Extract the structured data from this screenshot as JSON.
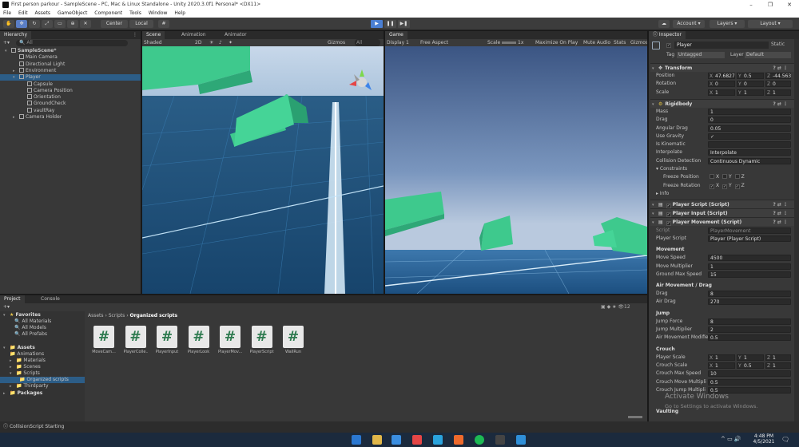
{
  "window": {
    "title": "First person parkour - SampleScene - PC, Mac & Linux Standalone - Unity 2020.3.0f1 Personal* <DX11>",
    "controls": [
      "–",
      "❐",
      "✕"
    ]
  },
  "menu": [
    "File",
    "Edit",
    "Assets",
    "GameObject",
    "Component",
    "Tools",
    "Window",
    "Help"
  ],
  "toolbar": {
    "pivot": "Center",
    "space": "Local",
    "account": "Account",
    "layers": "Layers",
    "layout": "Layout"
  },
  "hierarchy": {
    "tab": "Hierarchy",
    "search": "All",
    "items": [
      {
        "label": "SampleScene*",
        "indent": 0
      },
      {
        "label": "Main Camera",
        "indent": 1
      },
      {
        "label": "Directional Light",
        "indent": 1
      },
      {
        "label": "Environment",
        "indent": 1
      },
      {
        "label": "Player",
        "indent": 1
      },
      {
        "label": "Capsule",
        "indent": 2
      },
      {
        "label": "Camera Position",
        "indent": 2
      },
      {
        "label": "Orientation",
        "indent": 2
      },
      {
        "label": "GroundCheck",
        "indent": 2
      },
      {
        "label": "vaultRay",
        "indent": 2
      },
      {
        "label": "Camera Holder",
        "indent": 1
      }
    ]
  },
  "scene": {
    "tabs": [
      "Scene",
      "Animation",
      "Animator"
    ],
    "shading": "Shaded",
    "mode2d": "2D",
    "gizmos": "Gizmos",
    "search": "All"
  },
  "game": {
    "tab": "Game",
    "display": "Display 1",
    "aspect": "Free Aspect",
    "scale_label": "Scale",
    "scale": "1x",
    "options": [
      "Maximize On Play",
      "Mute Audio",
      "Stats",
      "Gizmos"
    ]
  },
  "project": {
    "tabs": [
      "Project",
      "Console"
    ],
    "favorites_label": "Favorites",
    "favorites": [
      "All Materials",
      "All Models",
      "All Prefabs"
    ],
    "assets_label": "Assets",
    "folders": [
      "Animations",
      "Materials",
      "Scenes",
      "Scripts",
      "Organized scripts",
      "Thirdparty"
    ],
    "packages_label": "Packages",
    "breadcrumb": [
      "Assets",
      "Scripts",
      "Organized scripts"
    ],
    "files": [
      "MoveCam...",
      "PlayerColle...",
      "PlayerInput",
      "PlayerLook",
      "PlayerMov...",
      "PlayerScript",
      "WallRun"
    ],
    "count": "12"
  },
  "status": {
    "message": "CollisionScript Starting"
  },
  "inspector": {
    "tab": "Inspector",
    "object": "Player",
    "static": "Static",
    "tag_label": "Tag",
    "tag": "Untagged",
    "layer_label": "Layer",
    "layer": "Default",
    "transform": {
      "title": "Transform",
      "rows": [
        {
          "label": "Position",
          "x": "47.6827",
          "y": "0.5",
          "z": "-44.563"
        },
        {
          "label": "Rotation",
          "x": "0",
          "y": "0",
          "z": "0"
        },
        {
          "label": "Scale",
          "x": "1",
          "y": "1",
          "z": "1"
        }
      ]
    },
    "rigidbody": {
      "title": "Rigidbody",
      "rows": [
        {
          "label": "Mass",
          "value": "1"
        },
        {
          "label": "Drag",
          "value": "0"
        },
        {
          "label": "Angular Drag",
          "value": "0.05"
        },
        {
          "label": "Use Gravity",
          "value": "✓"
        },
        {
          "label": "Is Kinematic",
          "value": ""
        },
        {
          "label": "Interpolate",
          "value": "Interpolate"
        },
        {
          "label": "Collision Detection",
          "value": "Continuous Dynamic"
        }
      ],
      "constraints": "Constraints",
      "freeze_pos": "Freeze Position",
      "freeze_rot": "Freeze Rotation",
      "axes": [
        "X",
        "Y",
        "Z"
      ],
      "info": "Info"
    },
    "components": [
      "Player Script (Script)",
      "Player Input (Script)",
      "Player Movement (Script)"
    ],
    "script_label": "Script",
    "script_value": "PlayerMovement",
    "player_script_label": "Player Script",
    "player_script_value": "Player (Player Script)",
    "movement": {
      "title": "Movement",
      "rows": [
        {
          "label": "Move Speed",
          "value": "4500"
        },
        {
          "label": "Move Multiplier",
          "value": "1"
        },
        {
          "label": "Ground Max Speed",
          "value": "15"
        }
      ]
    },
    "air": {
      "title": "Air Movement / Drag",
      "rows": [
        {
          "label": "Drag",
          "value": "8"
        },
        {
          "label": "Air Drag",
          "value": "270"
        }
      ]
    },
    "jump": {
      "title": "Jump",
      "rows": [
        {
          "label": "Jump Force",
          "value": "8"
        },
        {
          "label": "Jump Multiplier",
          "value": "2"
        },
        {
          "label": "Air Movement Modifie",
          "value": "0.5"
        }
      ]
    },
    "crouch": {
      "title": "Crouch",
      "player_scale": {
        "label": "Player Scale",
        "x": "1",
        "y": "1",
        "z": "1"
      },
      "crouch_scale": {
        "label": "Crouch Scale",
        "x": "1",
        "y": "0.5",
        "z": "1"
      },
      "rows": [
        {
          "label": "Crouch Max Speed",
          "value": "10"
        },
        {
          "label": "Crouch Move Multipli",
          "value": "0.5"
        },
        {
          "label": "Crouch Jump Multipli",
          "value": "0.5"
        }
      ]
    },
    "vaulting": "Vaulting"
  },
  "watermark": {
    "line1": "Activate Windows",
    "line2": "Go to Settings to activate Windows."
  },
  "taskbar": {
    "time": "4:48 PM",
    "date": "4/5/2021"
  },
  "colors": {
    "selection": "#2c5d87",
    "play_active": "#4a7fd3",
    "platform_green": "#3ec98d"
  }
}
